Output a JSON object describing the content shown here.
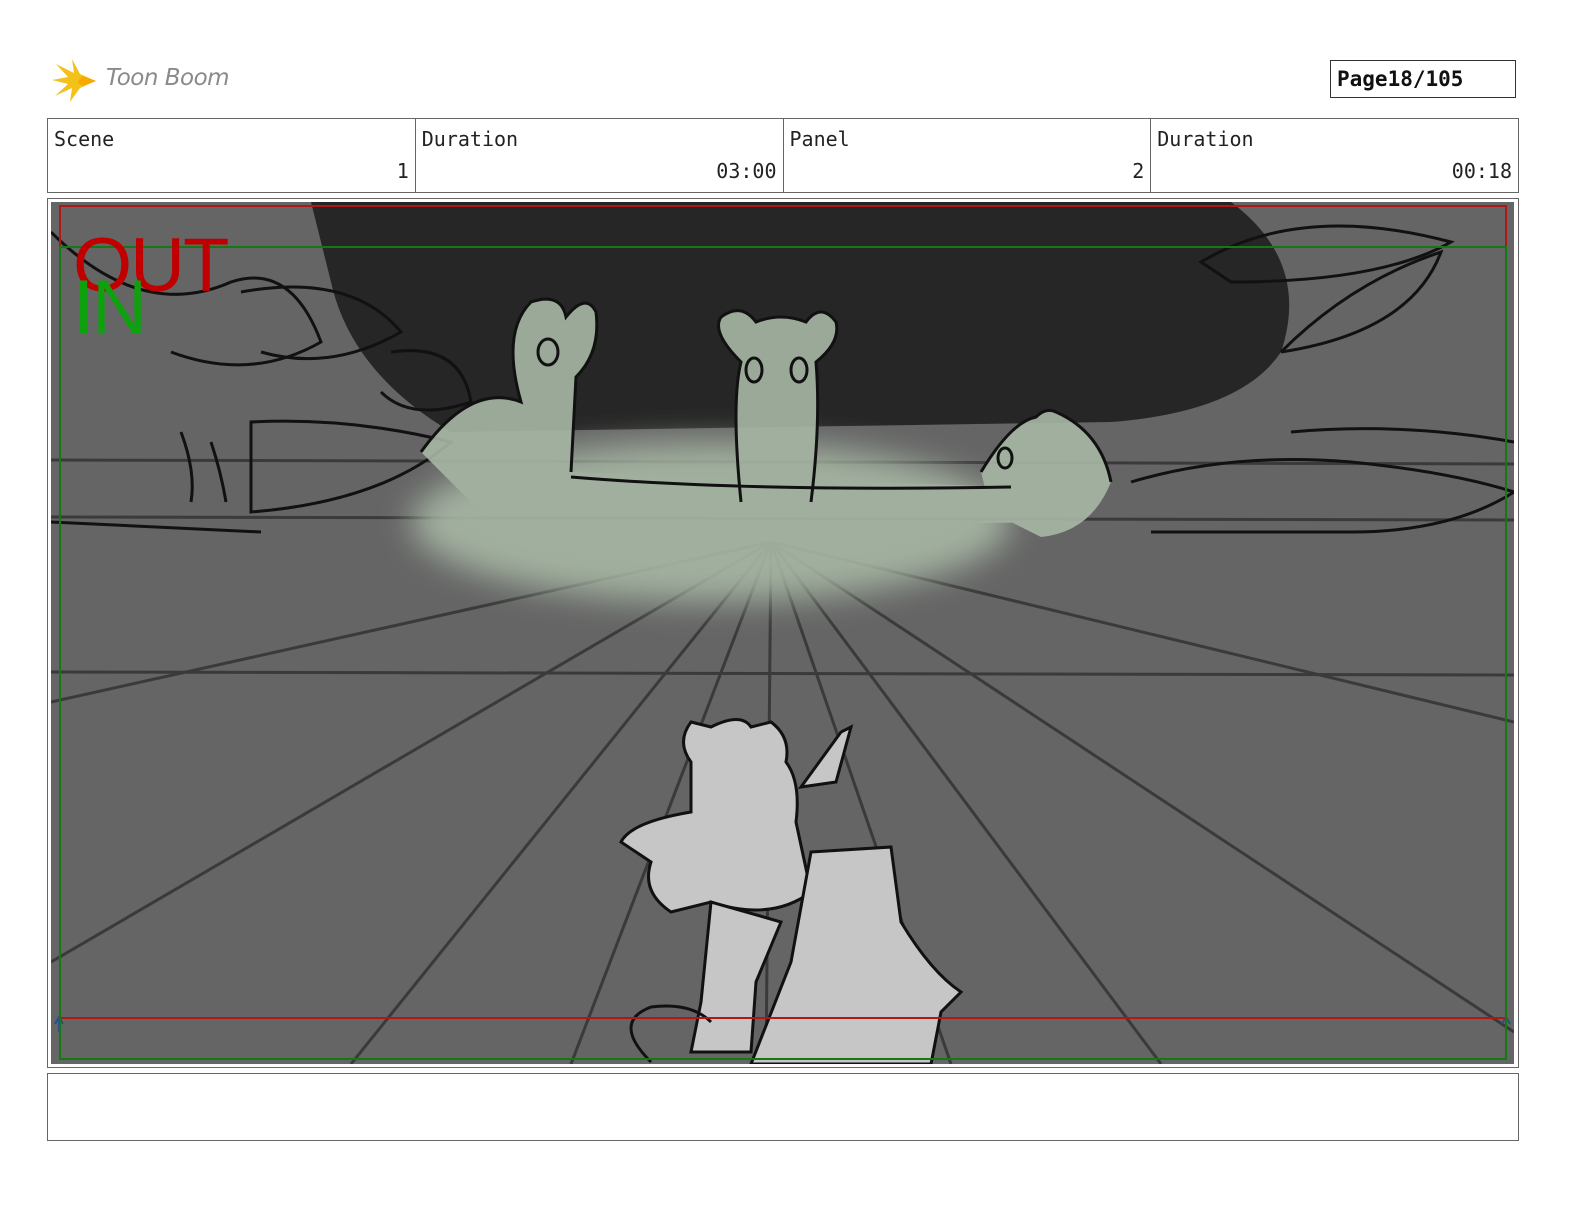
{
  "header": {
    "logo_text": "Toon Boom",
    "logo_icon": "burst-icon",
    "page_label": "Page",
    "page_number": "18/105"
  },
  "info": {
    "scene_label": "Scene",
    "scene_value": "1",
    "scene_duration_label": "Duration",
    "scene_duration_value": "03:00",
    "panel_label": "Panel",
    "panel_value": "2",
    "panel_duration_label": "Duration",
    "panel_duration_value": "00:18"
  },
  "panel": {
    "out_label": "OUT",
    "in_label": "IN",
    "colors": {
      "out_frame": "#b01818",
      "in_frame": "#137a13",
      "background": "#656565",
      "cave": "#262626",
      "glow": "#a8b8a5"
    }
  },
  "notes": {
    "text": ""
  }
}
